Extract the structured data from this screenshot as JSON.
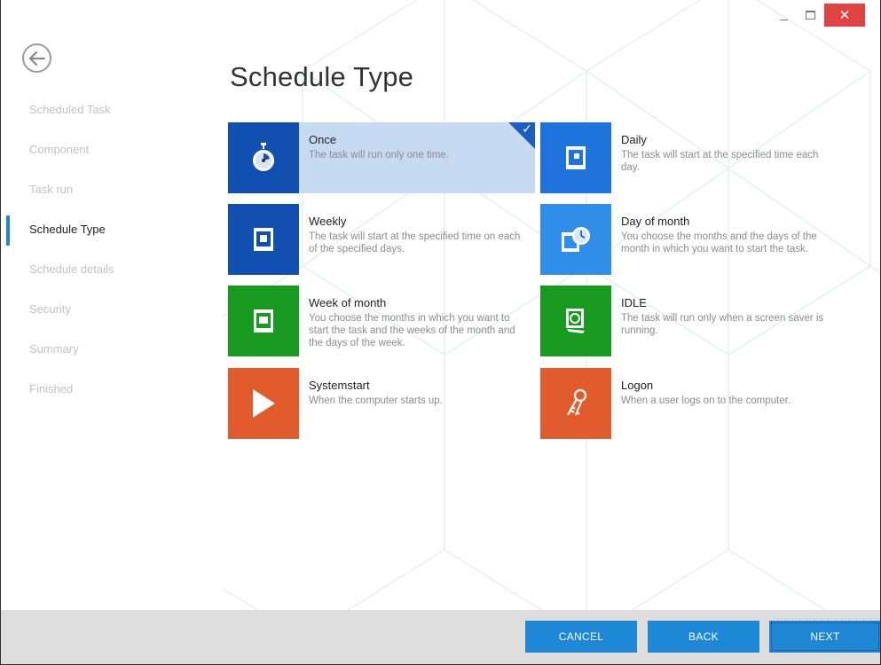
{
  "window": {
    "controls": {
      "minimize_icon": "minimize-icon",
      "maximize_icon": "maximize-icon",
      "close_glyph": "✕"
    }
  },
  "nav": {
    "back_icon": "back-arrow-icon",
    "items": [
      {
        "label": "Scheduled Task",
        "active": false
      },
      {
        "label": "Component",
        "active": false
      },
      {
        "label": "Task run",
        "active": false
      },
      {
        "label": "Schedule Type",
        "active": true
      },
      {
        "label": "Schedule details",
        "active": false
      },
      {
        "label": "Security",
        "active": false
      },
      {
        "label": "Summary",
        "active": false
      },
      {
        "label": "Finished",
        "active": false
      }
    ]
  },
  "page": {
    "title": "Schedule Type"
  },
  "tiles": [
    {
      "title": "Once",
      "desc": "The task will run only one time.",
      "icon": "stopwatch-icon",
      "color": "#1150b0",
      "selected": true
    },
    {
      "title": "Daily",
      "desc": "The task will start at the specified time each day.",
      "icon": "calendar-day-icon",
      "color": "#1e74dc",
      "selected": false
    },
    {
      "title": "Weekly",
      "desc": "The task will start at the specified time on each of the specified days.",
      "icon": "calendar-week-icon",
      "color": "#1150b0",
      "selected": false
    },
    {
      "title": "Day of month",
      "desc": "You choose the months and the days of the month in which you want to start the task.",
      "icon": "calendar-clock-icon",
      "color": "#2e8ee8",
      "selected": false
    },
    {
      "title": "Week of month",
      "desc": "You choose the months in which you want to start the task and the weeks of the month and the days of the week.",
      "icon": "calendar-month-icon",
      "color": "#179a1f",
      "selected": false
    },
    {
      "title": "IDLE",
      "desc": "The task will run only when a screen saver is running.",
      "icon": "screen-saver-icon",
      "color": "#179a1f",
      "selected": false
    },
    {
      "title": "Systemstart",
      "desc": "When the computer starts up.",
      "icon": "play-icon",
      "color": "#e15b2d",
      "selected": false
    },
    {
      "title": "Logon",
      "desc": "When a user logs on to the computer.",
      "icon": "keys-icon",
      "color": "#e15b2d",
      "selected": false
    }
  ],
  "footer": {
    "cancel_label": "CANCEL",
    "back_label": "BACK",
    "next_label": "NEXT"
  },
  "colors": {
    "accent": "#1e88d6",
    "selected_tile": "#c6daf2",
    "close_button": "#e04343"
  }
}
